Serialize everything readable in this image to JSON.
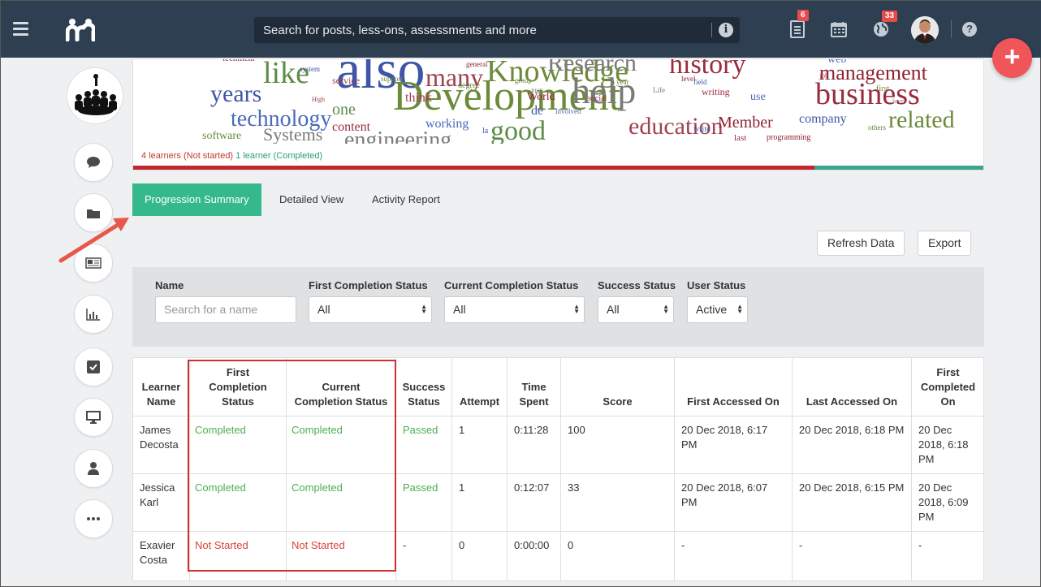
{
  "search": {
    "placeholder": "Search for posts, less-ons, assessments and more"
  },
  "notifications": {
    "docs_count": "6",
    "globe_count": "33"
  },
  "banner": {
    "not_started_text": "4 learners (Not started)",
    "completed_text": "1 learner (Completed)",
    "not_started_fraction": 0.8,
    "words": [
      "technical",
      "also",
      "Knowledge",
      "Research",
      "history",
      "web",
      "like",
      "many",
      "management",
      "years",
      "Development",
      "help",
      "business",
      "technology",
      "one",
      "think",
      "World",
      "de",
      "related",
      "Systems",
      "content",
      "working",
      "good",
      "education",
      "Member",
      "company",
      "software",
      "engineering",
      "writing",
      "use",
      "degree",
      "service",
      "general",
      "system",
      "support",
      "PHP",
      "social",
      "involved",
      "year",
      "High",
      "programming",
      "field",
      "first",
      "love",
      "last",
      "write",
      "others",
      "job",
      "level",
      "la",
      "group",
      "Life"
    ]
  },
  "tabs": [
    "Progression Summary",
    "Detailed View",
    "Activity Report"
  ],
  "actions": {
    "refresh": "Refresh Data",
    "export": "Export"
  },
  "filters": {
    "name_label": "Name",
    "name_placeholder": "Search for a name",
    "first_completion_label": "First Completion Status",
    "first_completion_value": "All",
    "current_completion_label": "Current Completion Status",
    "current_completion_value": "All",
    "success_label": "Success Status",
    "success_value": "All",
    "user_status_label": "User Status",
    "user_status_value": "Active"
  },
  "table": {
    "headers": [
      "Learner Name",
      "First Completion Status",
      "Current Completion Status",
      "Success Status",
      "Attempt",
      "Time Spent",
      "Score",
      "First Accessed On",
      "Last Accessed On",
      "First Completed On"
    ],
    "rows": [
      [
        "James Decosta",
        "Completed",
        "Completed",
        "Passed",
        "1",
        "0:11:28",
        "100",
        "20 Dec 2018, 6:17 PM",
        "20 Dec 2018, 6:18 PM",
        "20 Dec 2018, 6:18 PM"
      ],
      [
        "Jessica Karl",
        "Completed",
        "Completed",
        "Passed",
        "1",
        "0:12:07",
        "33",
        "20 Dec 2018, 6:07 PM",
        "20 Dec 2018, 6:15 PM",
        "20 Dec 2018, 6:09 PM"
      ],
      [
        "Exavier Costa",
        "Not Started",
        "Not Started",
        "-",
        "0",
        "0:00:00",
        "0",
        "-",
        "-",
        "-"
      ]
    ]
  },
  "colors": {
    "topbar": "#2e3f52",
    "tab_active": "#35b98c",
    "fab": "#f0555a",
    "completed": "#4caf50",
    "not_started": "#d9413a"
  }
}
